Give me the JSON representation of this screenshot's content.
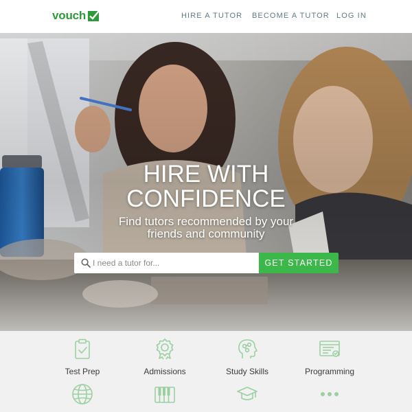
{
  "header": {
    "logo": "vouch",
    "nav": {
      "hire": "HIRE A TUTOR",
      "become": "BECOME A TUTOR",
      "login": "LOG IN"
    }
  },
  "hero": {
    "title_line1": "HIRE WITH",
    "title_line2": "CONFIDENCE",
    "subtitle_line1": "Find tutors recommended by your",
    "subtitle_line2": "friends and community",
    "search": {
      "placeholder": "I need a tutor for...",
      "button": "GET STARTED"
    }
  },
  "categories": [
    {
      "label": "Test Prep",
      "icon": "clipboard-check-icon"
    },
    {
      "label": "Admissions",
      "icon": "award-ribbon-icon"
    },
    {
      "label": "Study Skills",
      "icon": "head-brain-icon"
    },
    {
      "label": "Programming",
      "icon": "code-window-icon"
    },
    {
      "label": "",
      "icon": "globe-icon"
    },
    {
      "label": "",
      "icon": "piano-keys-icon"
    },
    {
      "label": "",
      "icon": "graduation-cap-icon"
    },
    {
      "label": "",
      "icon": "more-dots-icon"
    }
  ],
  "colors": {
    "brand_green": "#2e9a3c",
    "button_green": "#3cb84a",
    "icon_green": "#9ad0a0",
    "nav_text": "#5f7a86",
    "category_bg": "#f1f1f1"
  }
}
